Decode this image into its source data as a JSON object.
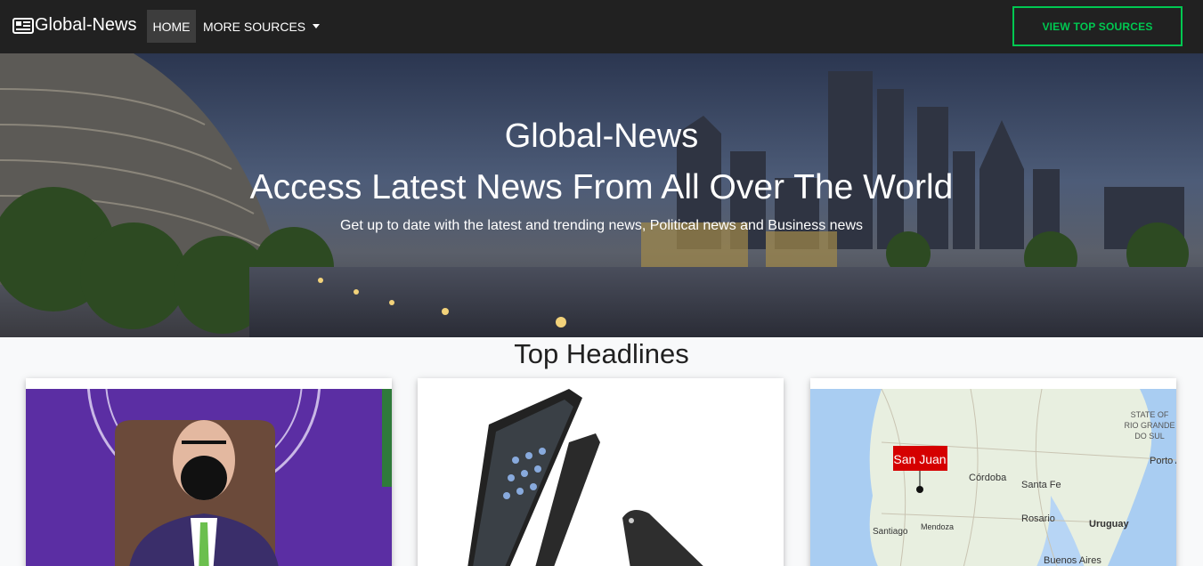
{
  "navbar": {
    "brand": "Global-News",
    "brand_icon": "newspaper-icon",
    "home_label": "HOME",
    "more_sources_label": "MORE SOURCES",
    "view_top_sources_label": "VIEW TOP SOURCES",
    "accent_color": "#00c851"
  },
  "hero": {
    "title": "Global-News",
    "subtitle": "Access Latest News From All Over The World",
    "description": "Get up to date with the latest and trending news, Political news and Business news"
  },
  "headlines": {
    "title": "Top Headlines",
    "cards": [
      {
        "image": "man-in-face-mask-at-podium"
      },
      {
        "image": "chromebook-laptops"
      },
      {
        "image": "map-of-south-america",
        "map_labels": [
          "San Juan",
          "Córdoba",
          "Santa Fe",
          "Rosario",
          "Mendoza",
          "Santiago",
          "Uruguay",
          "Buenos Aires",
          "Porto A",
          "STATE OF",
          "RIO GRANDE",
          "DO SUL"
        ]
      }
    ]
  }
}
